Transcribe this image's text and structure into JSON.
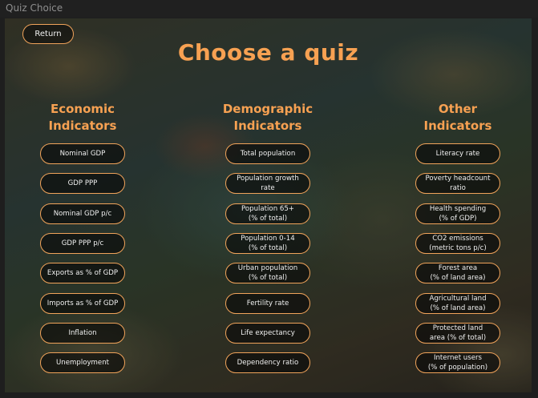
{
  "window": {
    "title": "Quiz Choice"
  },
  "return_label": "Return",
  "page_title": "Choose a quiz",
  "columns": [
    {
      "title_lines": [
        "Economic",
        "Indicators"
      ],
      "items": [
        {
          "lines": [
            "Nominal GDP"
          ]
        },
        {
          "lines": [
            "GDP PPP"
          ]
        },
        {
          "lines": [
            "Nominal GDP p/c"
          ]
        },
        {
          "lines": [
            "GDP PPP p/c"
          ]
        },
        {
          "lines": [
            "Exports as % of GDP"
          ]
        },
        {
          "lines": [
            "Imports as % of GDP"
          ]
        },
        {
          "lines": [
            "Inflation"
          ]
        },
        {
          "lines": [
            "Unemployment"
          ]
        }
      ]
    },
    {
      "title_lines": [
        "Demographic",
        "Indicators"
      ],
      "items": [
        {
          "lines": [
            "Total population"
          ]
        },
        {
          "lines": [
            "Population growth",
            "rate"
          ]
        },
        {
          "lines": [
            "Population 65+",
            "(% of total)"
          ]
        },
        {
          "lines": [
            "Population 0-14",
            "(% of total)"
          ]
        },
        {
          "lines": [
            "Urban population",
            "(% of total)"
          ]
        },
        {
          "lines": [
            "Fertility rate"
          ]
        },
        {
          "lines": [
            "Life expectancy"
          ]
        },
        {
          "lines": [
            "Dependency ratio"
          ]
        }
      ]
    },
    {
      "title_lines": [
        "Other",
        "Indicators"
      ],
      "items": [
        {
          "lines": [
            "Literacy rate"
          ]
        },
        {
          "lines": [
            "Poverty headcount",
            "ratio"
          ]
        },
        {
          "lines": [
            "Health spending",
            "(% of GDP)"
          ]
        },
        {
          "lines": [
            "CO2 emissions",
            "(metric tons p/c)"
          ]
        },
        {
          "lines": [
            "Forest area",
            "(% of land area)"
          ]
        },
        {
          "lines": [
            "Agricultural land",
            "(% of land area)"
          ]
        },
        {
          "lines": [
            "Protected land",
            "area (% of total)"
          ]
        },
        {
          "lines": [
            "Internet users",
            "(% of population)"
          ]
        }
      ]
    }
  ],
  "colors": {
    "accent": "#f7a152",
    "border": "#f0a35a",
    "pill_bg": "#0a0a0a"
  }
}
